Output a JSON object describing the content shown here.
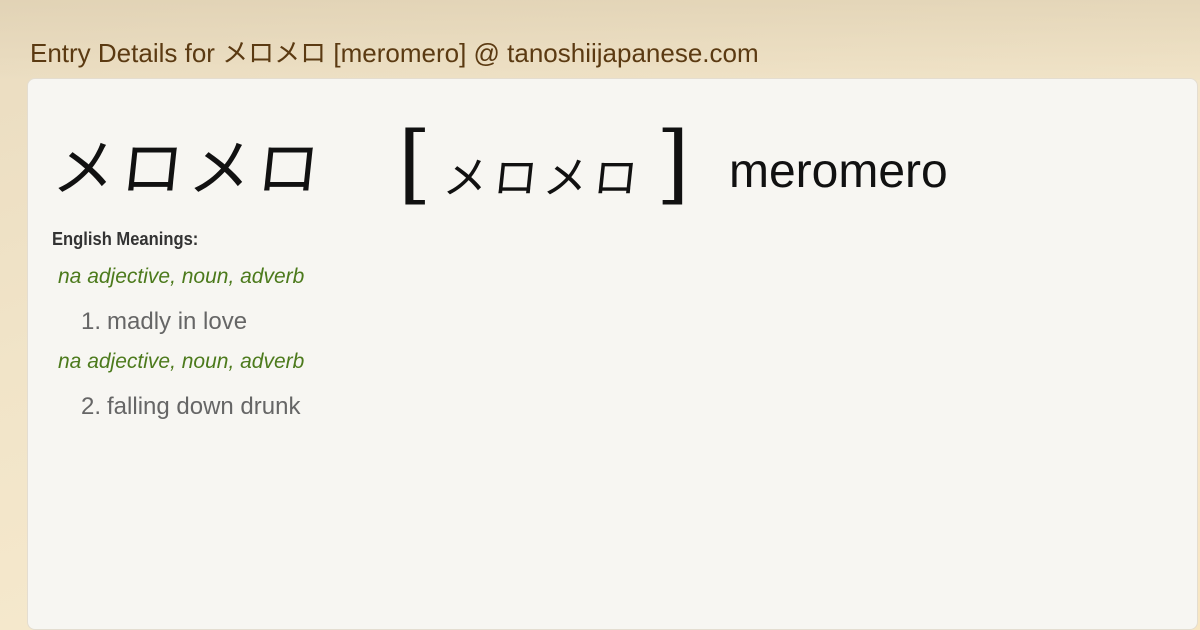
{
  "page": {
    "title": "Entry Details for メロメロ [meromero] @ tanoshiijapanese.com"
  },
  "entry": {
    "kanji": "メロメロ",
    "bracket_open": "[",
    "reading": "メロメロ",
    "bracket_close": "]",
    "romaji": "meromero"
  },
  "meanings": {
    "heading": "English Meanings:",
    "senses": [
      {
        "pos": "na adjective, noun, adverb",
        "number": "1.",
        "text": "madly in love"
      },
      {
        "pos": "na adjective, noun, adverb",
        "number": "2.",
        "text": "falling down drunk"
      }
    ]
  },
  "colors": {
    "title": "#5b3a12",
    "pos": "#4c7a1c",
    "definition": "#666666",
    "card": "#f7f6f2"
  }
}
